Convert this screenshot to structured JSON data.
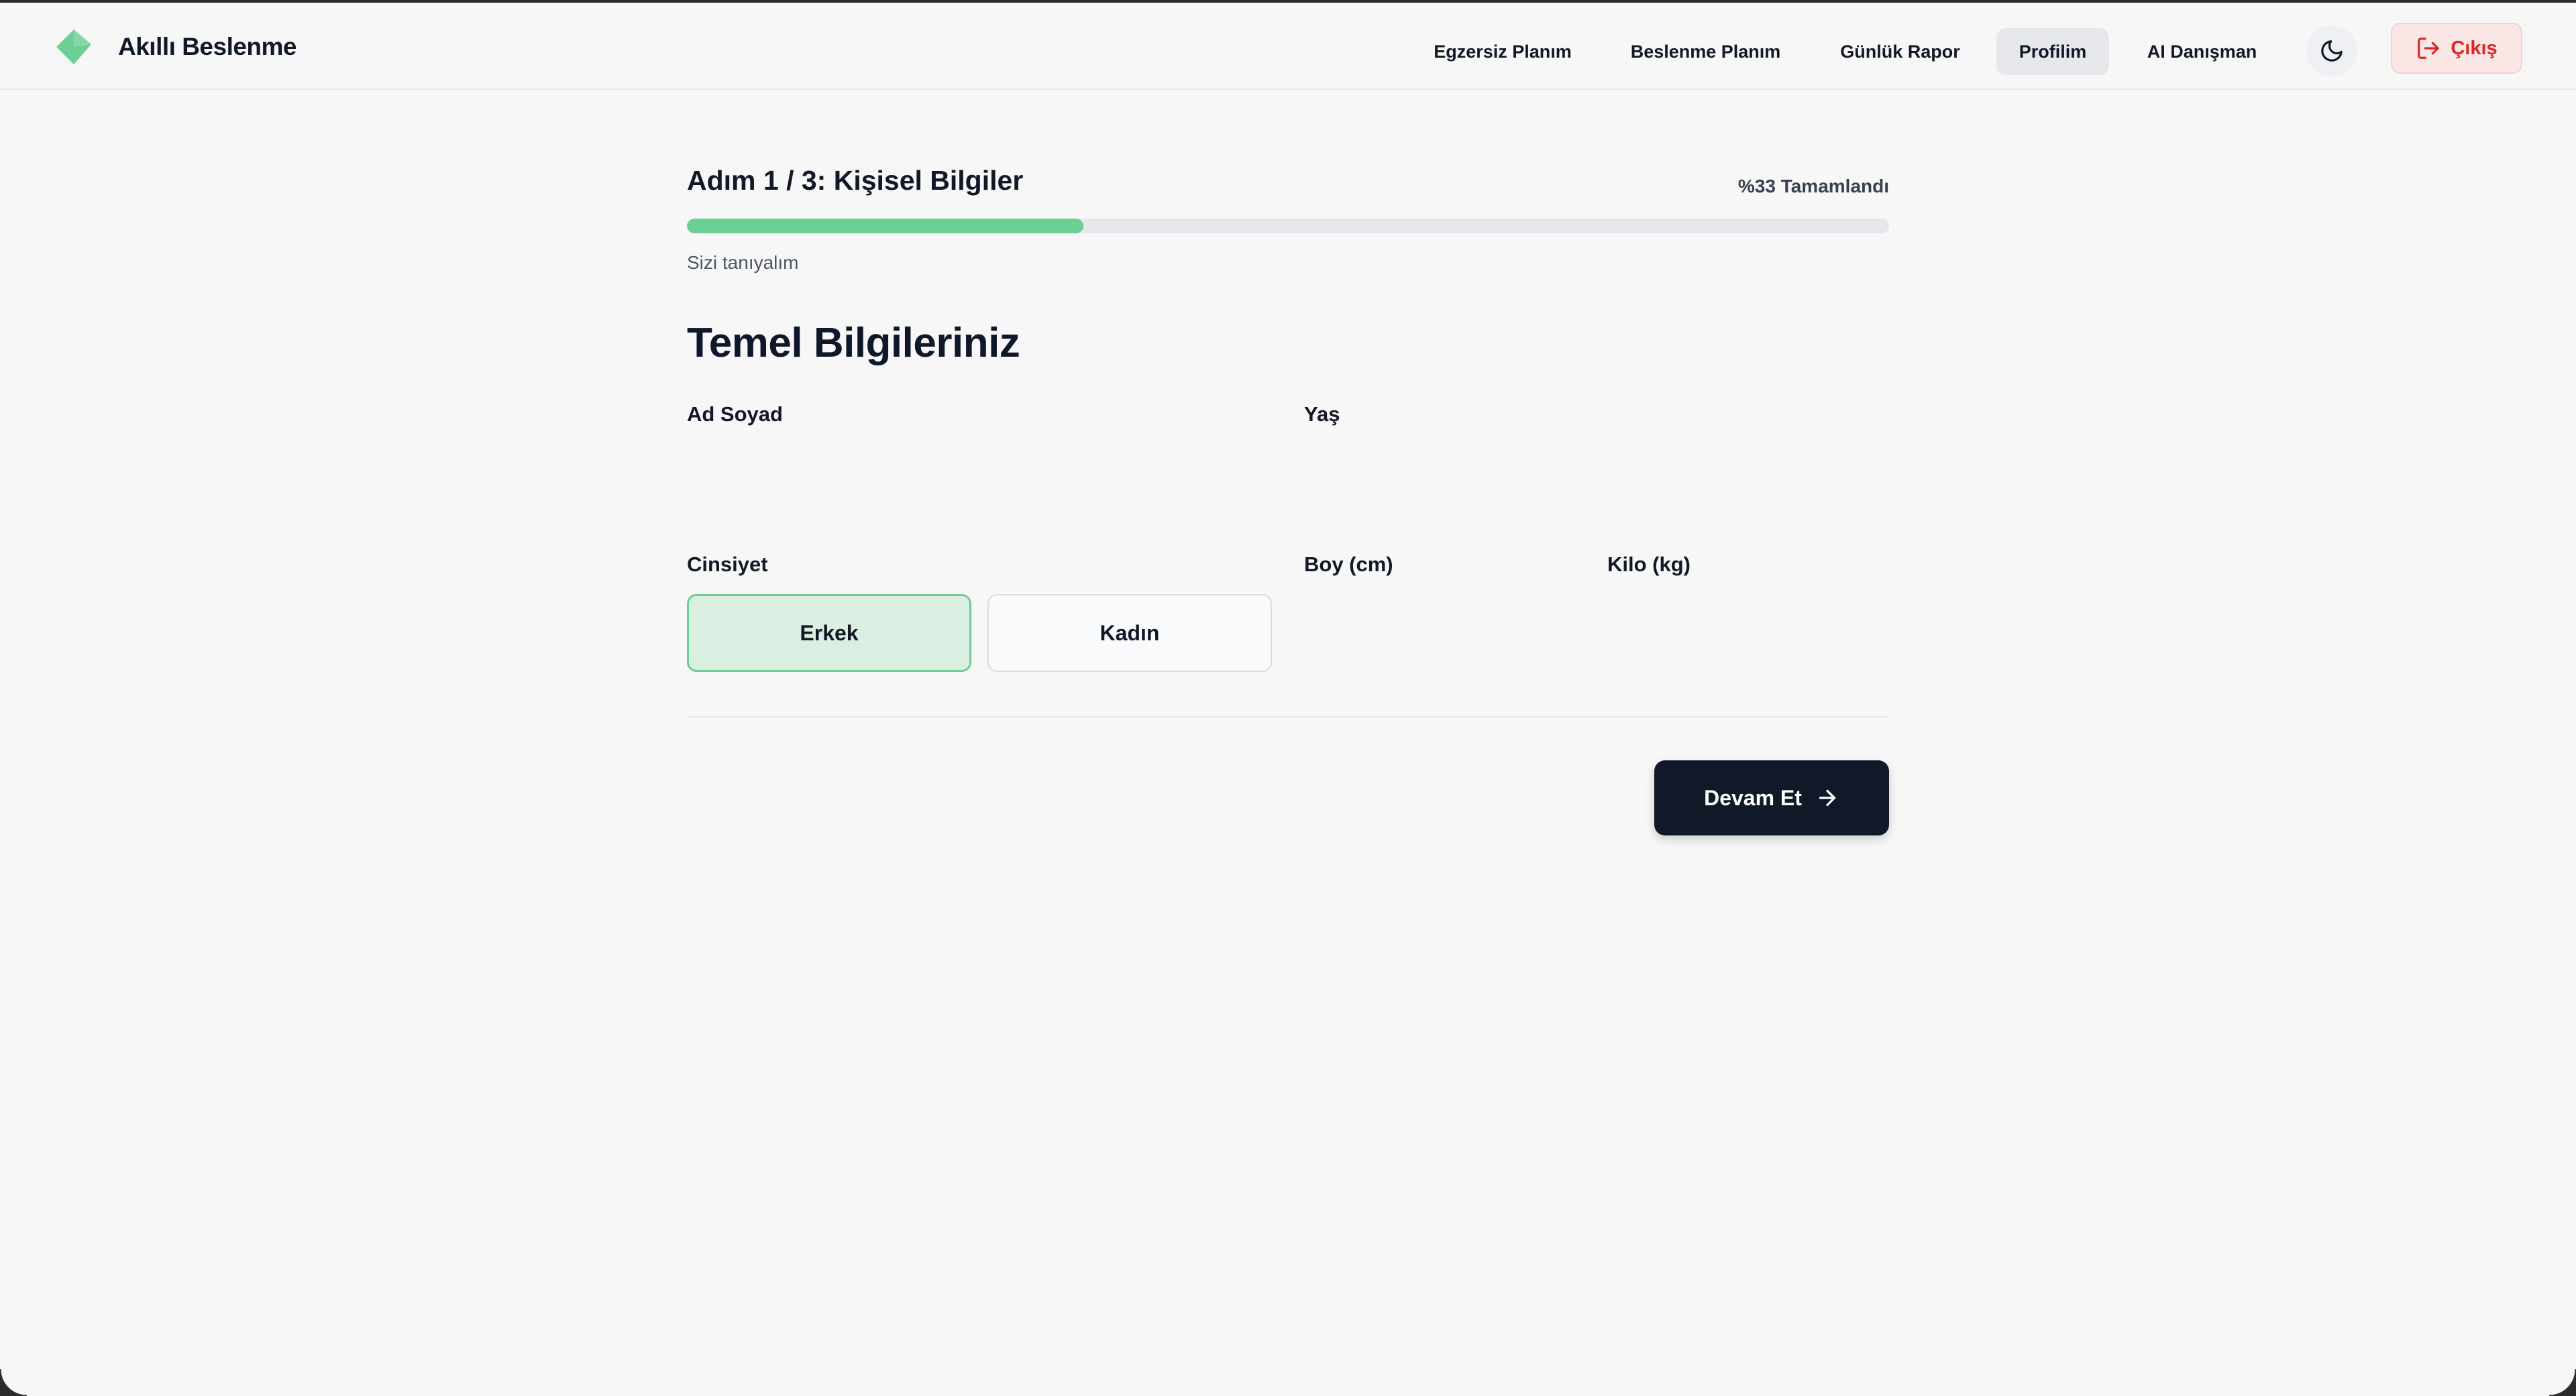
{
  "app": {
    "brand_name": "Akıllı Beslenme",
    "brand_icon": "leaf-gem-icon",
    "accent_color": "#6ccf93"
  },
  "nav": {
    "items": [
      {
        "label": "Egzersiz Planım",
        "active": false
      },
      {
        "label": "Beslenme Planım",
        "active": false
      },
      {
        "label": "Günlük Rapor",
        "active": false
      },
      {
        "label": "Profilim",
        "active": true
      },
      {
        "label": "AI Danışman",
        "active": false
      }
    ],
    "theme_toggle_icon": "moon-icon",
    "logout_label": "Çıkış",
    "logout_icon": "logout-icon",
    "logout_color": "#dc2626"
  },
  "wizard": {
    "step_title": "Adım 1 / 3: Kişisel Bilgiler",
    "progress_text": "%33 Tamamlandı",
    "progress_percent": 33,
    "subtitle": "Sizi tanıyalım"
  },
  "form": {
    "section_title": "Temel Bilgileriniz",
    "name_label": "Ad Soyad",
    "name_value": "",
    "age_label": "Yaş",
    "age_value": "",
    "gender_label": "Cinsiyet",
    "gender_options": [
      {
        "label": "Erkek",
        "selected": true
      },
      {
        "label": "Kadın",
        "selected": false
      }
    ],
    "height_label": "Boy (cm)",
    "height_value": "",
    "weight_label": "Kilo (kg)",
    "weight_value": ""
  },
  "actions": {
    "continue_label": "Devam Et",
    "continue_icon": "arrow-right-icon"
  }
}
